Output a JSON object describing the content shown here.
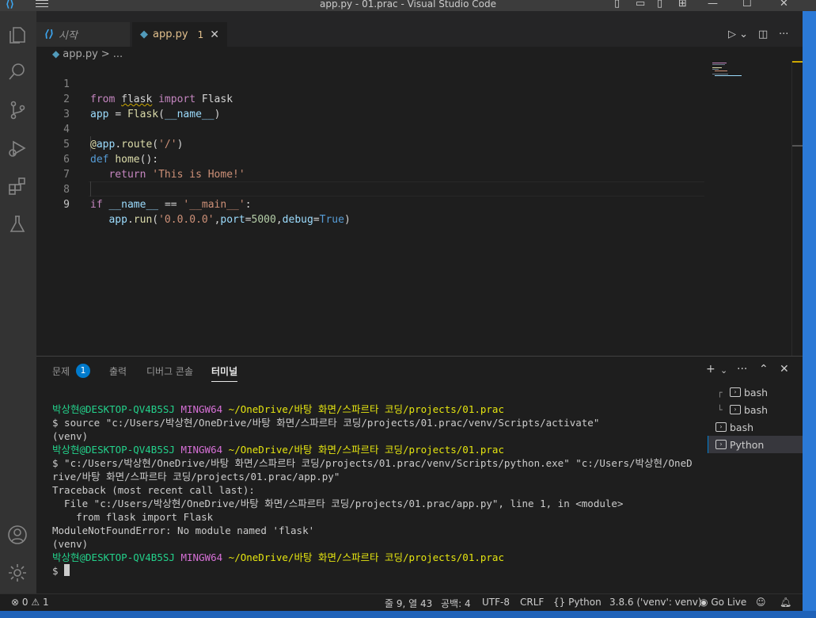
{
  "window": {
    "title": "app.py - 01.prac - Visual Studio Code"
  },
  "activity_bar": {
    "icons": [
      "explorer-icon",
      "search-icon",
      "source-control-icon",
      "run-debug-icon",
      "extensions-icon",
      "testing-icon",
      "account-icon",
      "settings-gear-icon"
    ]
  },
  "tabs": [
    {
      "label": "시작",
      "icon": "vscode-icon"
    },
    {
      "label": "app.py",
      "icon": "python-icon",
      "problems": "1",
      "close": "✕"
    }
  ],
  "breadcrumb": {
    "file": "app.py",
    "sep": ">",
    "rest": "..."
  },
  "editor": {
    "line_numbers": [
      "1",
      "2",
      "3",
      "4",
      "5",
      "6",
      "7",
      "8",
      "9"
    ],
    "current_line": 9,
    "lines": [
      "from flask import Flask",
      "app = Flask(__name__)",
      "",
      "@app.route('/')",
      "def home():",
      "    return 'This is Home!'",
      "",
      "if __name__ == '__main__':",
      "    app.run('0.0.0.0',port=5000,debug=True)"
    ]
  },
  "panel": {
    "tabs": [
      {
        "label": "문제",
        "badge": "1"
      },
      {
        "label": "출력"
      },
      {
        "label": "디버그 콘솔"
      },
      {
        "label": "터미널",
        "active": true
      }
    ],
    "actions": [
      "+",
      "⌄",
      "···",
      "⌃",
      "✕"
    ]
  },
  "terminal": {
    "prompt_user": "박상현@DESKTOP-QV4B5SJ",
    "prompt_env": "MINGW64",
    "prompt_path": "~/OneDrive/바탕 화면/스파르타 코딩/projects/01.prac",
    "lines": [
      "$ source \"c:/Users/박상현/OneDrive/바탕 화면/스파르타 코딩/projects/01.prac/venv/Scripts/activate\"",
      "(venv)",
      "$ \"c:/Users/박상현/OneDrive/바탕 화면/스파르타 코딩/projects/01.prac/venv/Scripts/python.exe\" \"c:/Users/박상현/OneD",
      "rive/바탕 화면/스파르타 코딩/projects/01.prac/app.py\"",
      "Traceback (most recent call last):",
      "  File \"c:/Users/박상현/OneDrive/바탕 화면/스파르타 코딩/projects/01.prac/app.py\", line 1, in <module>",
      "    from flask import Flask",
      "ModuleNotFoundError: No module named 'flask'",
      "(venv)",
      "$ "
    ]
  },
  "terminal_list": [
    {
      "label": "bash",
      "tree": "┌"
    },
    {
      "label": "bash",
      "tree": "└"
    },
    {
      "label": "bash",
      "tree": ""
    },
    {
      "label": "Python",
      "tree": "",
      "active": true
    }
  ],
  "status_bar": {
    "errors": "0",
    "warnings": "1",
    "position": "줄 9, 열 43",
    "spaces": "공백: 4",
    "encoding": "UTF-8",
    "eol": "CRLF",
    "language": "Python",
    "interpreter": "3.8.6 ('venv': venv)",
    "go_live": "Go Live"
  },
  "colors": {
    "accent": "#007acc",
    "modified_tab": "#e2c08d",
    "prompt_green": "#23d18b",
    "prompt_magenta": "#d670d6",
    "prompt_yellow": "#e5e510"
  }
}
